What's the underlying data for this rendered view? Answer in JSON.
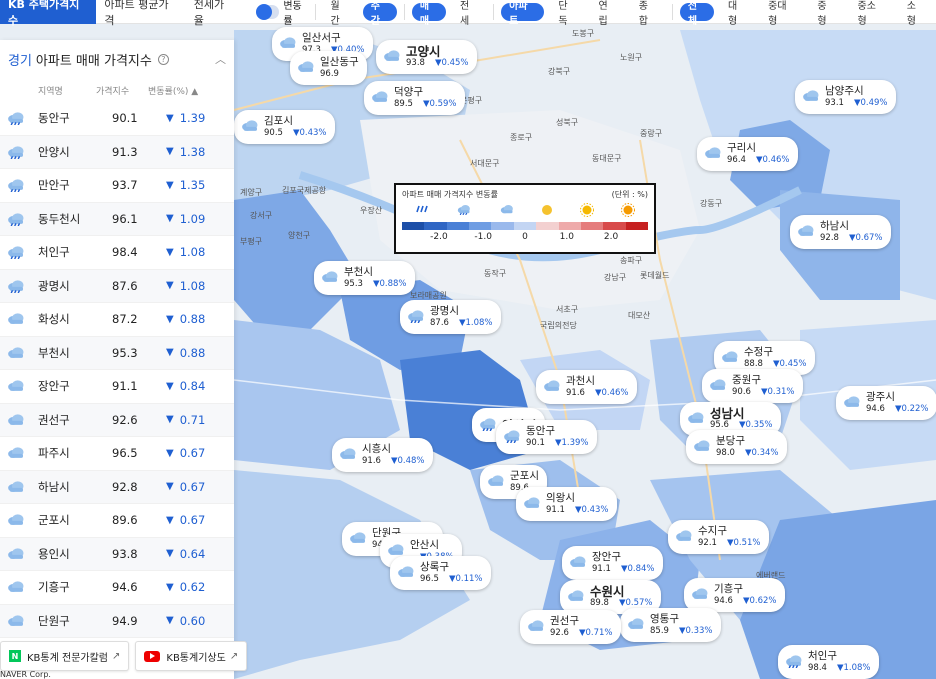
{
  "topbar": {
    "tabs": [
      "KB 주택가격지수",
      "아파트 평균가격",
      "전세가율"
    ],
    "toggle_label": "변동률",
    "period": [
      "월간",
      "주간"
    ],
    "deal": [
      "매매",
      "전세"
    ],
    "housing": [
      "아파트",
      "단독",
      "연립",
      "종합"
    ],
    "size": [
      "전체",
      "대형",
      "중대형",
      "중형",
      "중소형",
      "소형"
    ]
  },
  "sidebar": {
    "region": "경기",
    "title": "아파트 매매 가격지수",
    "help": "?",
    "collapse": "︿",
    "columns": [
      "지역명",
      "가격지수",
      "변동률(%) ▲"
    ],
    "rows": [
      {
        "name": "동안구",
        "price": "90.1",
        "change": "1.39",
        "icon": "rain-cloud-icon"
      },
      {
        "name": "안양시",
        "price": "91.3",
        "change": "1.38",
        "icon": "rain-cloud-icon"
      },
      {
        "name": "만안구",
        "price": "93.7",
        "change": "1.35",
        "icon": "rain-cloud-icon"
      },
      {
        "name": "동두천시",
        "price": "96.1",
        "change": "1.09",
        "icon": "rain-cloud-icon"
      },
      {
        "name": "처인구",
        "price": "98.4",
        "change": "1.08",
        "icon": "rain-cloud-icon"
      },
      {
        "name": "광명시",
        "price": "87.6",
        "change": "1.08",
        "icon": "rain-cloud-icon"
      },
      {
        "name": "화성시",
        "price": "87.2",
        "change": "0.88",
        "icon": "cloud-icon"
      },
      {
        "name": "부천시",
        "price": "95.3",
        "change": "0.88",
        "icon": "cloud-icon"
      },
      {
        "name": "장안구",
        "price": "91.1",
        "change": "0.84",
        "icon": "cloud-icon"
      },
      {
        "name": "권선구",
        "price": "92.6",
        "change": "0.71",
        "icon": "cloud-icon"
      },
      {
        "name": "파주시",
        "price": "96.5",
        "change": "0.67",
        "icon": "cloud-icon"
      },
      {
        "name": "하남시",
        "price": "92.8",
        "change": "0.67",
        "icon": "cloud-icon"
      },
      {
        "name": "군포시",
        "price": "89.6",
        "change": "0.67",
        "icon": "cloud-icon"
      },
      {
        "name": "용인시",
        "price": "93.8",
        "change": "0.64",
        "icon": "cloud-icon"
      },
      {
        "name": "기흥구",
        "price": "94.6",
        "change": "0.62",
        "icon": "cloud-icon"
      },
      {
        "name": "단원구",
        "price": "94.9",
        "change": "0.60",
        "icon": "cloud-icon"
      }
    ],
    "partial_row_price": "9."
  },
  "links": {
    "expert": "KB통계 전문가칼럼",
    "weather": "KB통계기상도",
    "ext_icon": "↗",
    "n_badge": "N"
  },
  "copyright": "NAVER Corp.",
  "legend": {
    "title": "아파트 매매 가격지수 변동률",
    "unit": "(단위 : %)",
    "ticks": [
      "-2.0",
      "-1.0",
      "0",
      "1.0",
      "2.0"
    ],
    "colors": [
      "#1d4fa8",
      "#2f66c4",
      "#4a80d6",
      "#6f9de3",
      "#9ab9ec",
      "#c3d5f3",
      "#f3d0d0",
      "#eeaaaa",
      "#e57c7c",
      "#d84a4a",
      "#c62020"
    ]
  },
  "map_labels": [
    {
      "name": "일산서구",
      "price": "97.3",
      "change": "0.40"
    },
    {
      "name": "일산동구",
      "price": "96.9",
      "change": ""
    },
    {
      "name": "고양시",
      "price": "93.8",
      "change": "0.45",
      "big": true
    },
    {
      "name": "덕양구",
      "price": "89.5",
      "change": "0.59"
    },
    {
      "name": "남양주시",
      "price": "93.1",
      "change": "0.49"
    },
    {
      "name": "김포시",
      "price": "90.5",
      "change": "0.43"
    },
    {
      "name": "구리시",
      "price": "96.4",
      "change": "0.46"
    },
    {
      "name": "하남시",
      "price": "92.8",
      "change": "0.67"
    },
    {
      "name": "부천시",
      "price": "95.3",
      "change": "0.88"
    },
    {
      "name": "광명시",
      "price": "87.6",
      "change": "1.08"
    },
    {
      "name": "수정구",
      "price": "88.8",
      "change": "0.45"
    },
    {
      "name": "중원구",
      "price": "90.6",
      "change": "0.31"
    },
    {
      "name": "과천시",
      "price": "91.6",
      "change": "0.46"
    },
    {
      "name": "광주시",
      "price": "94.6",
      "change": "0.22"
    },
    {
      "name": "성남시",
      "price": "95.6",
      "change": "0.35",
      "big": true
    },
    {
      "name": "분당구",
      "price": "98.0",
      "change": "0.34"
    },
    {
      "name": "안양시",
      "price": "",
      "change": "",
      "big": true
    },
    {
      "name": "동안구",
      "price": "90.1",
      "change": "1.39"
    },
    {
      "name": "시흥시",
      "price": "91.6",
      "change": "0.48"
    },
    {
      "name": "군포시",
      "price": "89.6",
      "change": ""
    },
    {
      "name": "의왕시",
      "price": "91.1",
      "change": "0.43"
    },
    {
      "name": "단원구",
      "price": "94.9",
      "change": "0.60"
    },
    {
      "name": "안산시",
      "price": "",
      "change": "0.38"
    },
    {
      "name": "상록구",
      "price": "96.5",
      "change": "0.11"
    },
    {
      "name": "수지구",
      "price": "92.1",
      "change": "0.51"
    },
    {
      "name": "장안구",
      "price": "91.1",
      "change": "0.84"
    },
    {
      "name": "수원시",
      "price": "89.8",
      "change": "0.57",
      "big": true
    },
    {
      "name": "기흥구",
      "price": "94.6",
      "change": "0.62"
    },
    {
      "name": "영통구",
      "price": "85.9",
      "change": "0.33"
    },
    {
      "name": "권선구",
      "price": "92.6",
      "change": "0.71"
    },
    {
      "name": "처인구",
      "price": "98.4",
      "change": "1.08"
    }
  ],
  "map_pois": [
    "도봉구",
    "노원구",
    "강북구",
    "성북구",
    "종로구",
    "중랑구",
    "서대문구",
    "동대문구",
    "은평구",
    "강동구",
    "동작구",
    "강남구",
    "서초구",
    "송파구",
    "양천구",
    "강서구",
    "계양구",
    "부평구",
    "남양주시",
    "보라매공원",
    "국립의전당",
    "대모산",
    "에버랜드",
    "롯데월드",
    "우장산",
    "김포국제공항"
  ]
}
